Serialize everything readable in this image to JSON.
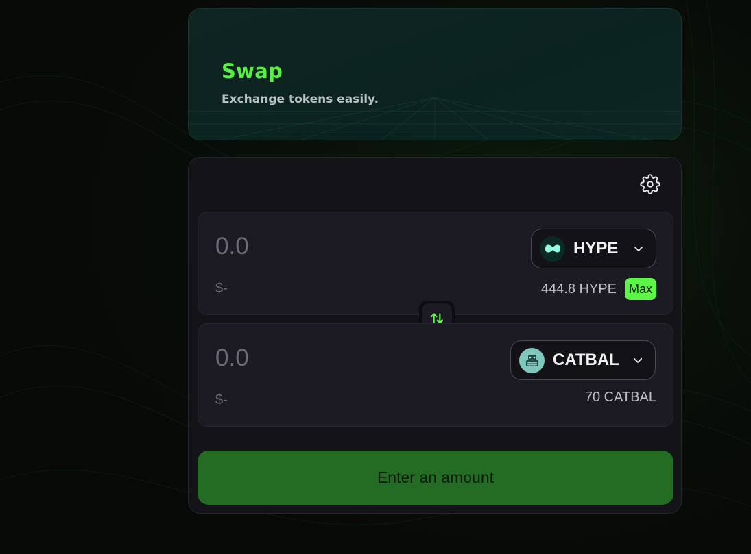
{
  "header": {
    "title": "Swap",
    "subtitle": "Exchange tokens easily."
  },
  "settings": {
    "icon": "gear-icon"
  },
  "from": {
    "placeholder": "0.0",
    "usd": "$-",
    "token": {
      "symbol": "HYPE",
      "icon": "hype-token-icon"
    },
    "balance": "444.8 HYPE",
    "max_label": "Max"
  },
  "to": {
    "placeholder": "0.0",
    "usd": "$-",
    "token": {
      "symbol": "CATBAL",
      "icon": "catbal-token-icon"
    },
    "balance": "70 CATBAL"
  },
  "swap_toggle": {
    "icon": "swap-arrows-icon"
  },
  "cta": {
    "label": "Enter an amount"
  },
  "colors": {
    "accent": "#58ef43",
    "max_bg": "#5cf746",
    "cta_bg": "#246b24",
    "card_bg": "#131318",
    "panel_bg": "#1c1b24"
  }
}
